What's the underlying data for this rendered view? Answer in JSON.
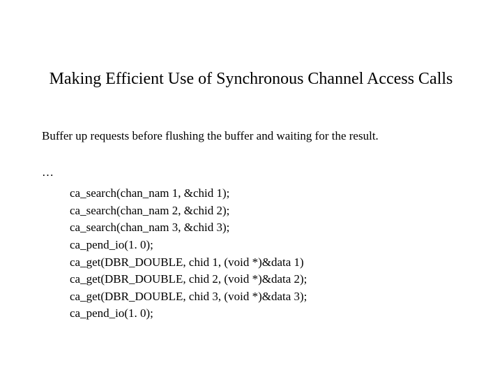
{
  "title": "Making Efficient Use of Synchronous Channel Access Calls",
  "intro": "Buffer up requests before flushing the buffer and waiting for the result.",
  "ellipsis": "…",
  "code": {
    "line1": "ca_search(chan_nam 1, &chid 1);",
    "line2": "ca_search(chan_nam 2, &chid 2);",
    "line3": "ca_search(chan_nam 3, &chid 3);",
    "line4": "ca_pend_io(1. 0);",
    "line5": "ca_get(DBR_DOUBLE, chid 1, (void *)&data 1)",
    "line6": "ca_get(DBR_DOUBLE, chid 2, (void *)&data 2);",
    "line7": "ca_get(DBR_DOUBLE, chid 3, (void *)&data 3);",
    "line8": "ca_pend_io(1. 0);"
  }
}
